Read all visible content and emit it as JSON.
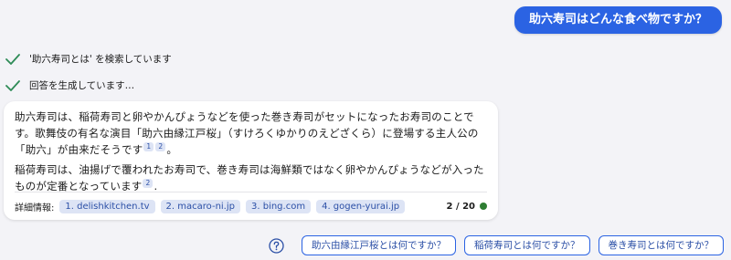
{
  "user_message": "助六寿司はどんな食べ物ですか？",
  "status": [
    {
      "text": "'助六寿司とは' を検索しています",
      "icon": "check-icon"
    },
    {
      "text": "回答を生成しています…",
      "icon": "check-icon"
    }
  ],
  "answer": {
    "para1_text": "助六寿司は、稲荷寿司と卵やかんぴょうなどを使った巻き寿司がセットになったお寿司のことです。歌舞伎の有名な演目「助六由縁江戸桜」（すけろくゆかりのえどざくら）に登場する主人公の「助六」が由来だそうです",
    "para1_cites": [
      "1",
      "2"
    ],
    "para1_end": "。",
    "para2_text": "稲荷寿司は、油揚げで覆われたお寿司で、巻き寿司は海鮮類ではなく卵やかんぴょうなどが入ったものが定番となっています",
    "para2_cite": "2",
    "para2_end": "."
  },
  "references": {
    "label": "詳細情報:",
    "items": [
      "1. delishkitchen.tv",
      "2. macaro-ni.jp",
      "3. bing.com",
      "4. gogen-yurai.jp"
    ],
    "counter": "2 / 20",
    "counter_dot_color": "#2e7d32"
  },
  "suggestions": {
    "help_icon": "question-circle-icon",
    "items": [
      "助六由縁江戸桜とは何ですか？",
      "稲荷寿司とは何ですか？",
      "巻き寿司とは何ですか？"
    ]
  },
  "colors": {
    "accent": "#2b63e3",
    "check": "#2e8b57",
    "chip_bg": "#dde4f5"
  }
}
